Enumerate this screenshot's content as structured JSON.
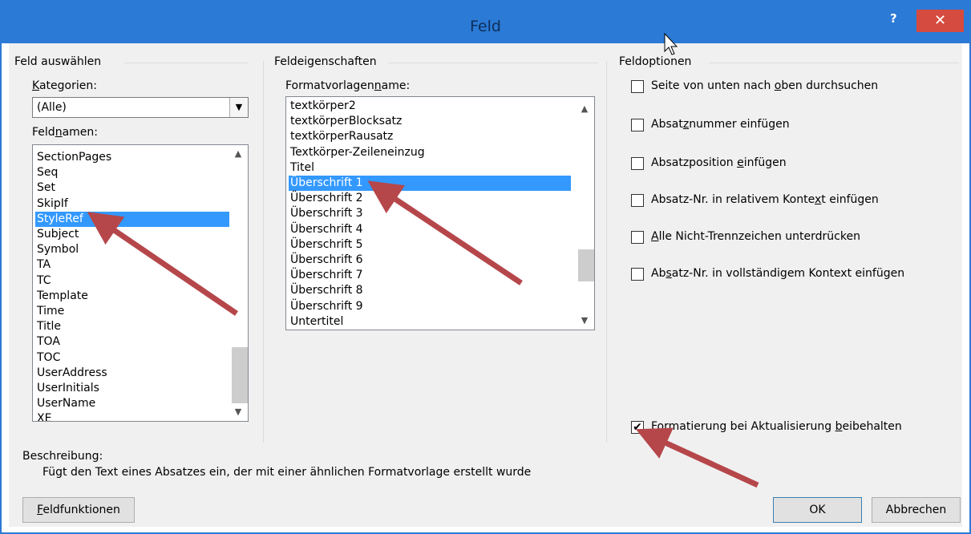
{
  "window": {
    "title": "Feld",
    "help": "?",
    "close": "✕"
  },
  "left": {
    "group_title": "Feld auswählen",
    "kategorien_label": "Kategorien:",
    "kategorien_value": "(Alle)",
    "feldnamen_label": "Feldnamen:",
    "feldnamen": [
      "SectionPages",
      "Seq",
      "Set",
      "SkipIf",
      "StyleRef",
      "Subject",
      "Symbol",
      "TA",
      "TC",
      "Template",
      "Time",
      "Title",
      "TOA",
      "TOC",
      "UserAddress",
      "UserInitials",
      "UserName",
      "XE"
    ],
    "selected_index": 4
  },
  "middle": {
    "group_title": "Feldeigenschaften",
    "formatvorlage_label": "Formatvorlagenname:",
    "styles": [
      "textkörper2",
      "textkörperBlocksatz",
      "textkörperRausatz",
      "Textkörper-Zeileneinzug",
      "Titel",
      "Überschrift 1",
      "Überschrift 2",
      "Überschrift 3",
      "Überschrift 4",
      "Überschrift 5",
      "Überschrift 6",
      "Überschrift 7",
      "Überschrift 8",
      "Überschrift 9",
      "Untertitel"
    ],
    "selected_index": 5
  },
  "right": {
    "group_title": "Feldoptionen",
    "options": [
      {
        "label": "Seite von unten nach oben durchsuchen",
        "checked": false
      },
      {
        "label": "Absatznummer einfügen",
        "checked": false
      },
      {
        "label": "Absatzposition einfügen",
        "checked": false
      },
      {
        "label": "Absatz-Nr. in relativem Kontext einfügen",
        "checked": false
      },
      {
        "label": "Alle Nicht-Trennzeichen unterdrücken",
        "checked": false
      },
      {
        "label": "Absatz-Nr. in vollständigem Kontext einfügen",
        "checked": false
      }
    ],
    "preserve_format": {
      "label": "Formatierung bei Aktualisierung beibehalten",
      "checked": true
    }
  },
  "description": {
    "label": "Beschreibung:",
    "text": "Fügt den Text eines Absatzes ein, der mit einer ähnlichen Formatvorlage erstellt wurde"
  },
  "buttons": {
    "feldfunktionen": "Feldfunktionen",
    "ok": "OK",
    "abbrechen": "Abbrechen"
  },
  "colors": {
    "titlebar": "#2b7ad6",
    "close": "#d54b3f",
    "selection": "#3399ff",
    "annotation_arrow": "#b5474a"
  }
}
